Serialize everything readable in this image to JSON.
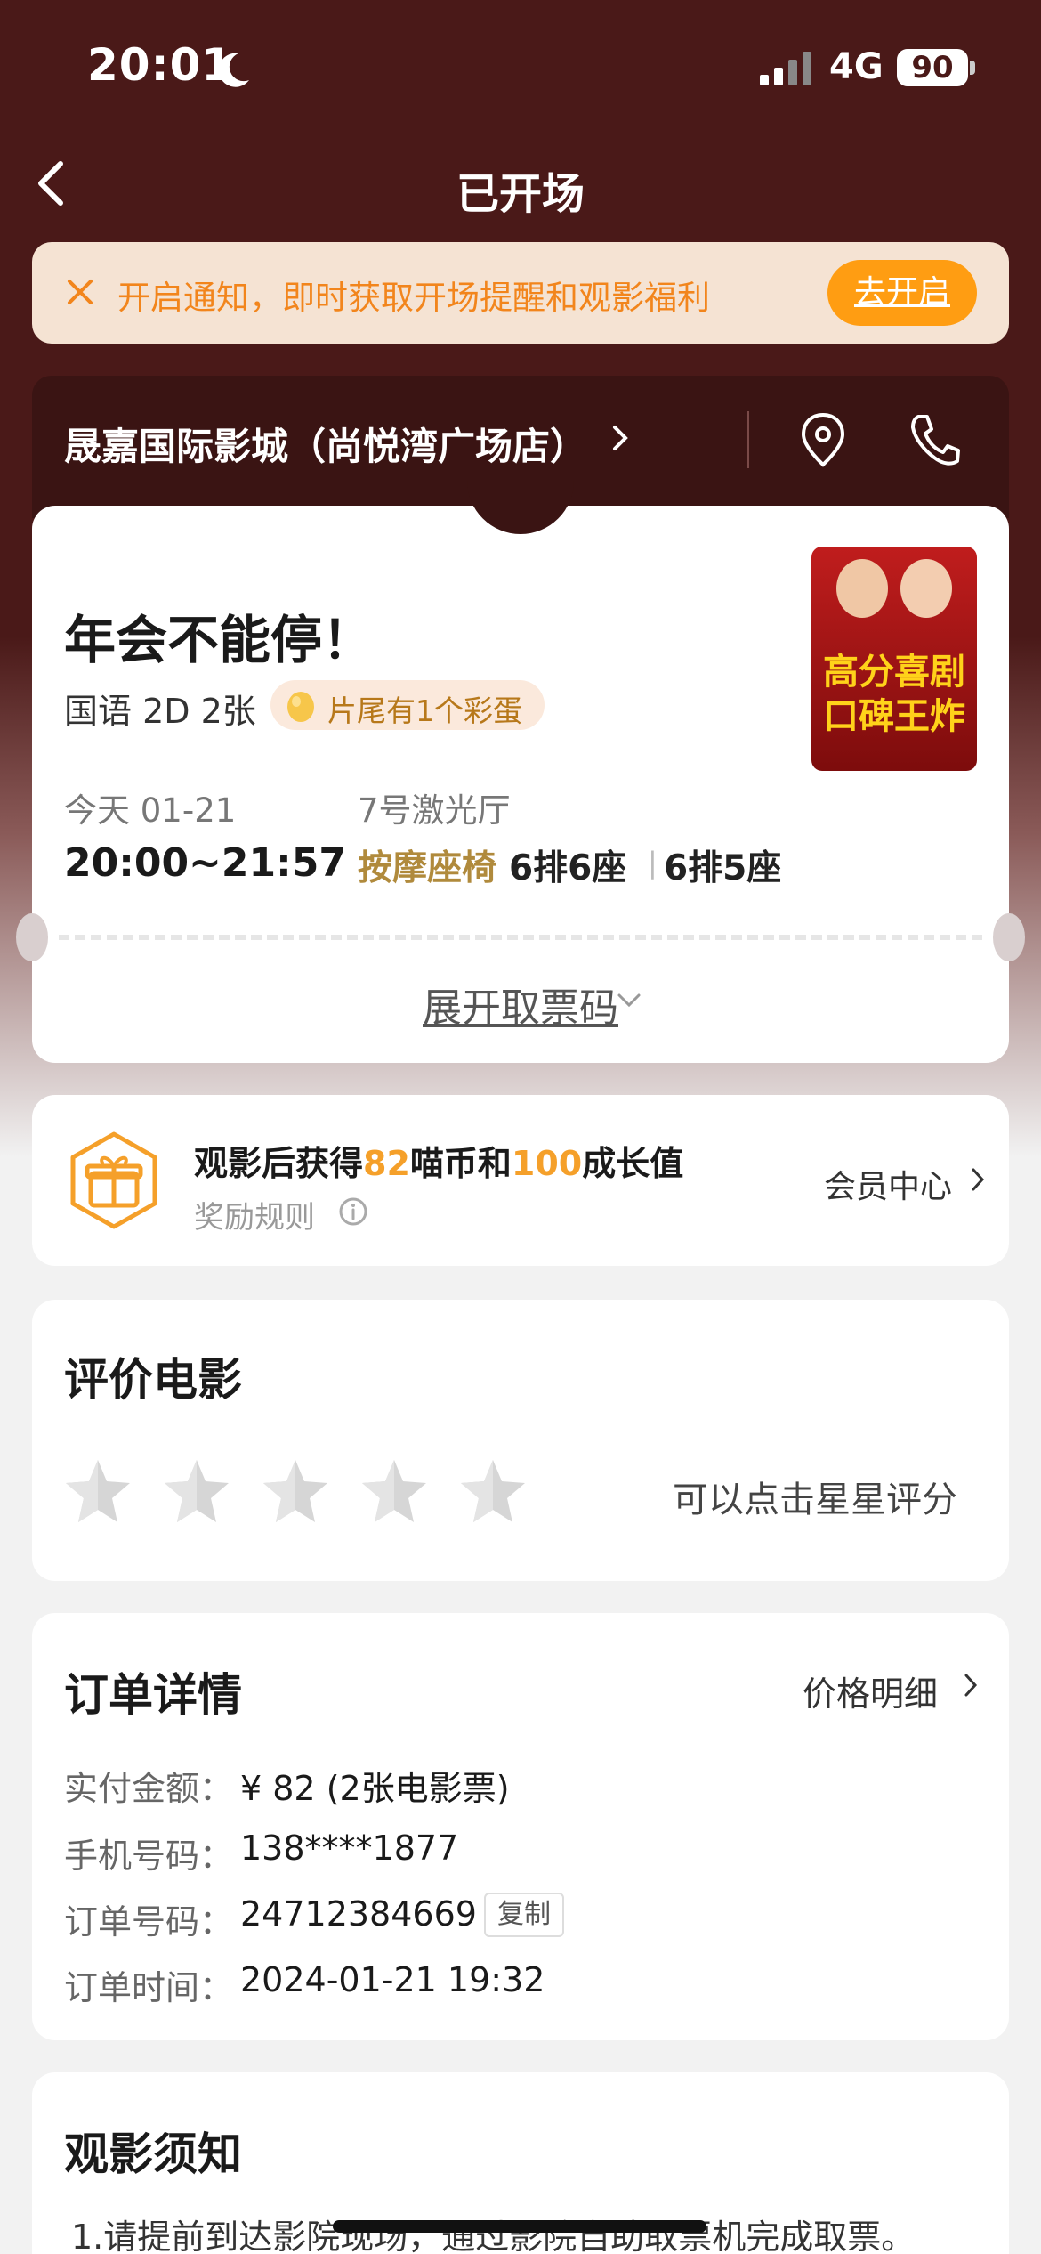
{
  "status_bar": {
    "time": "20:01",
    "network": "4G",
    "battery": "90"
  },
  "nav": {
    "title": "已开场"
  },
  "notify": {
    "text": "开启通知，即时获取开场提醒和观影福利",
    "button": "去开启"
  },
  "cinema": {
    "name": "晟嘉国际影城（尚悦湾广场店）"
  },
  "movie": {
    "title": "年会不能停！",
    "meta": "国语 2D 2张",
    "egg": "片尾有1个彩蛋",
    "poster_text": "高分喜剧 口碑王炸",
    "date": "今天 01-21",
    "time_range": "20:00~21:57",
    "hall": "7号激光厅",
    "seat_type": "按摩座椅",
    "seats": [
      "6排6座",
      "6排5座"
    ],
    "expand": "展开取票码"
  },
  "reward": {
    "text_pre": "观影后获得",
    "coins": "82",
    "text_mid": "喵币和",
    "growth": "100",
    "text_post": "成长值",
    "rule": "奖励规则",
    "member": "会员中心"
  },
  "rating": {
    "title": "评价电影",
    "hint": "可以点击星星评分",
    "stars": 5,
    "value": 0
  },
  "order": {
    "title": "订单详情",
    "price_detail": "价格明细",
    "rows": [
      {
        "label": "实付金额：",
        "value": "¥ 82 (2张电影票)"
      },
      {
        "label": "手机号码：",
        "value": "138****1877"
      },
      {
        "label": "订单号码：",
        "value": "24712384669"
      },
      {
        "label": "订单时间：",
        "value": "2024-01-21 19:32"
      }
    ],
    "copy": "复制"
  },
  "notice": {
    "title": "观影须知",
    "text": "1.请提前到达影院现场，通过影院自助取票机完成取票。"
  },
  "colors": {
    "header_bg": "#4a1918",
    "accent": "#ff9d12",
    "gold": "#b08a3c",
    "reward_orange": "#f5a02a"
  }
}
